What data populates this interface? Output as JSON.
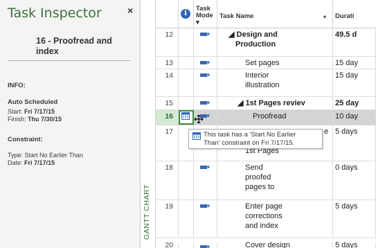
{
  "inspector": {
    "title": "Task Inspector",
    "close": "×",
    "task_line1": "16 - Proofread and",
    "task_line2": "index",
    "info_label": "INFO:",
    "scheduled": "Auto Scheduled",
    "start_label": "Start: ",
    "start_value": "Fri 7/17/15",
    "finish_label": "Finish: ",
    "finish_value": "Thu 7/30/15",
    "constraint_label": "Constraint:",
    "type_line": "Type: Start No Earlier Than",
    "date_label": "Date: ",
    "date_value": "Fri 7/17/15"
  },
  "view_label": "GANTT CHART",
  "columns": {
    "info_icon": "i",
    "mode_line1": "Task",
    "mode_line2": "Mode ▾",
    "name": "Task Name",
    "name_arrow": "▾",
    "duration": "Durati"
  },
  "rows": [
    {
      "id": "12",
      "name_l1": "◢ Design and",
      "name_l2": "Production",
      "duration": "49.5 d"
    },
    {
      "id": "13",
      "name_l1": "Set pages",
      "duration": "15 day"
    },
    {
      "id": "14",
      "name_l1": "Interior",
      "name_l2": "illustration",
      "duration": "15 day"
    },
    {
      "id": "15",
      "name_l1": "◢ 1st Pages reviev",
      "duration": "25 day"
    },
    {
      "id": "16",
      "name_l1": "Proofread",
      "duration": "10 day"
    },
    {
      "id": "17",
      "name_l1": "e",
      "name_l2": "1st Pages",
      "duration": "5 days"
    },
    {
      "id": "18",
      "name_l1": "Send",
      "name_l2": "proofed",
      "name_l3": "pages to",
      "duration": "0 days"
    },
    {
      "id": "19",
      "name_l1": "Enter page",
      "name_l2": "corrections",
      "name_l3": "and index",
      "duration": "5 days"
    },
    {
      "id": "20",
      "name_l1": "Cover design",
      "duration": "5 days"
    }
  ],
  "tooltip": {
    "line1": "This task has a 'Start No Earlier",
    "line2": "Than' constraint on Fri 7/17/15."
  },
  "colors": {
    "accent_green": "#3c6f3c",
    "mode_icon_blue": "#3a66b3",
    "selection_gray": "#d4d4d4"
  }
}
